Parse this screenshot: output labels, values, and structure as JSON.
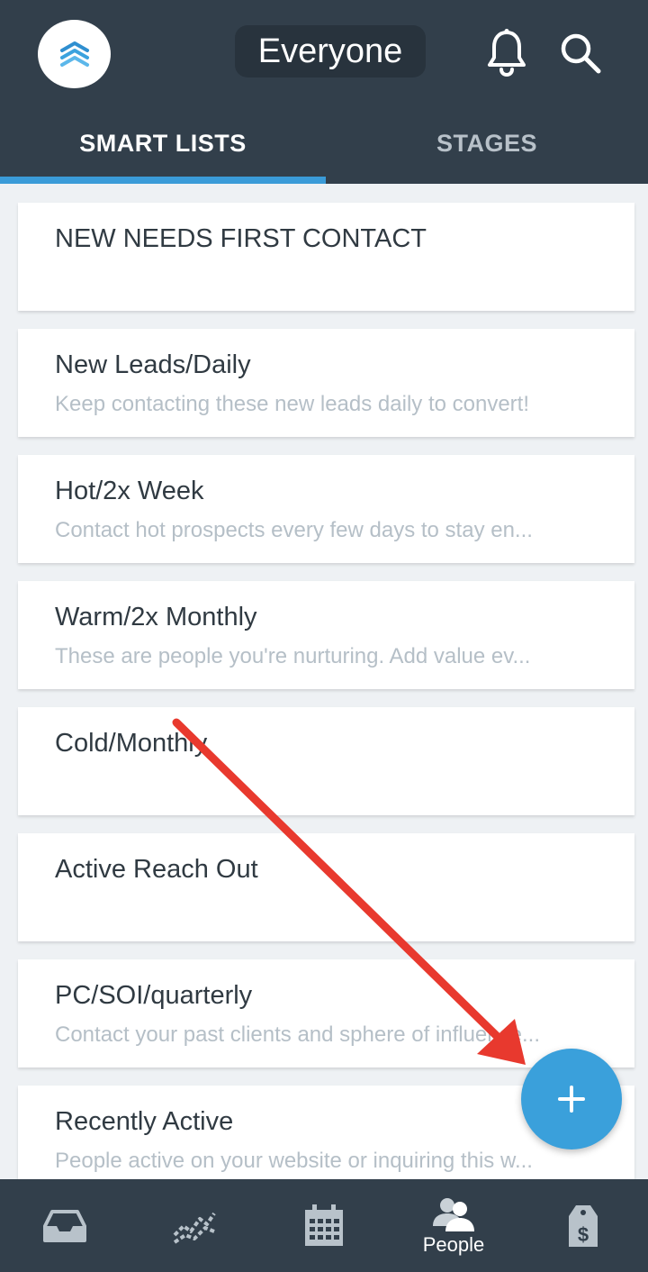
{
  "header": {
    "filter_label": "Everyone"
  },
  "tabs": [
    {
      "label": "SMART LISTS",
      "active": true
    },
    {
      "label": "STAGES",
      "active": false
    }
  ],
  "smart_lists": [
    {
      "title": "NEW NEEDS FIRST CONTACT",
      "subtitle": ""
    },
    {
      "title": "New Leads/Daily",
      "subtitle": "Keep contacting these new leads daily to convert!"
    },
    {
      "title": "Hot/2x Week",
      "subtitle": "Contact hot prospects every few days to stay en..."
    },
    {
      "title": "Warm/2x Monthly",
      "subtitle": "These are people you're nurturing. Add value ev..."
    },
    {
      "title": "Cold/Monthly",
      "subtitle": ""
    },
    {
      "title": "Active Reach Out",
      "subtitle": ""
    },
    {
      "title": "PC/SOI/quarterly",
      "subtitle": "Contact your past clients and sphere of influence..."
    },
    {
      "title": "Recently Active",
      "subtitle": "People active on your website or inquiring this w..."
    }
  ],
  "fab": {
    "icon": "plus-icon"
  },
  "bottom_nav": [
    {
      "icon": "inbox-icon",
      "label": ""
    },
    {
      "icon": "activity-chart-icon",
      "label": ""
    },
    {
      "icon": "calendar-icon",
      "label": ""
    },
    {
      "icon": "people-icon",
      "label": "People"
    },
    {
      "icon": "deals-tag-icon",
      "label": ""
    }
  ],
  "colors": {
    "header_bg": "#323f4b",
    "accent": "#3a9bd8",
    "fab": "#3aa0db",
    "annotation_arrow": "#e8392e"
  }
}
